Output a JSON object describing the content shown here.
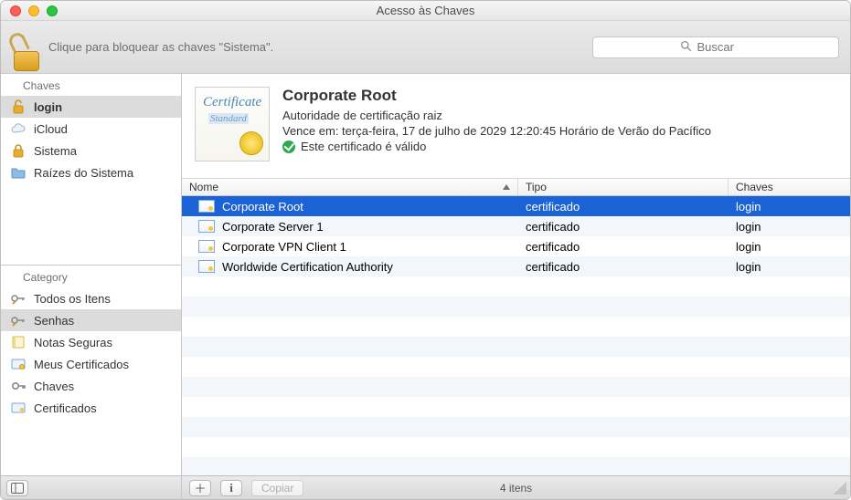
{
  "window": {
    "title": "Acesso às Chaves"
  },
  "toolbar": {
    "lock_hint": "Clique para bloquear as chaves \"Sistema\".",
    "search_placeholder": "Buscar"
  },
  "sidebar": {
    "keychains_header": "Chaves",
    "keychains": [
      {
        "id": "login",
        "label": "login",
        "icon": "lock-open",
        "selected": true,
        "bold": true
      },
      {
        "id": "icloud",
        "label": "iCloud",
        "icon": "cloud"
      },
      {
        "id": "sistema",
        "label": "Sistema",
        "icon": "lock-closed"
      },
      {
        "id": "raizes",
        "label": "Raízes do Sistema",
        "icon": "folder"
      }
    ],
    "category_header": "Category",
    "categories": [
      {
        "id": "all",
        "label": "Todos os Itens",
        "icon": "key-pen"
      },
      {
        "id": "passwords",
        "label": "Senhas",
        "icon": "key-pen",
        "selected": true
      },
      {
        "id": "notes",
        "label": "Notas Seguras",
        "icon": "note"
      },
      {
        "id": "mycerts",
        "label": "Meus Certificados",
        "icon": "cert-badge"
      },
      {
        "id": "keys",
        "label": "Chaves",
        "icon": "key"
      },
      {
        "id": "certs",
        "label": "Certificados",
        "icon": "cert"
      }
    ]
  },
  "detail": {
    "name": "Corporate Root",
    "kind": "Autoridade de certificação raiz",
    "expires": "Vence em: terça-feira, 17 de julho de 2029 12:20:45 Horário de Verão do Pacífico",
    "valid_text": "Este certificado é válido",
    "thumb_word1": "Certificate",
    "thumb_word2": "Standard"
  },
  "table": {
    "columns": {
      "name": "Nome",
      "type": "Tipo",
      "keychain": "Chaves"
    },
    "rows": [
      {
        "name": "Corporate Root",
        "type": "certificado",
        "keychain": "login",
        "selected": true
      },
      {
        "name": "Corporate Server 1",
        "type": "certificado",
        "keychain": "login"
      },
      {
        "name": "Corporate VPN Client 1",
        "type": "certificado",
        "keychain": "login"
      },
      {
        "name": "Worldwide Certification Authority",
        "type": "certificado",
        "keychain": "login"
      }
    ]
  },
  "status": {
    "copy_label": "Copiar",
    "count_text": "4 itens"
  }
}
